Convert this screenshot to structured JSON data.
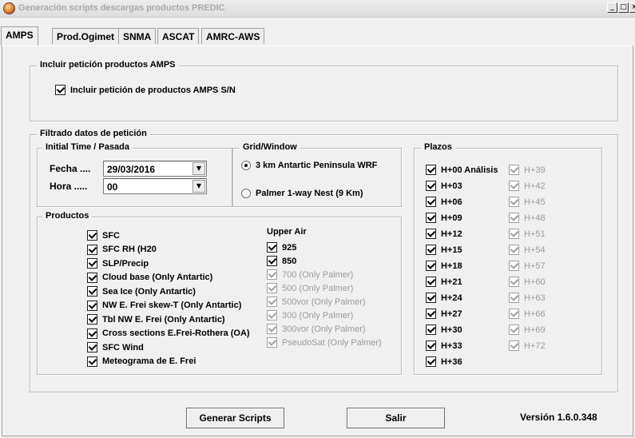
{
  "window": {
    "title": "Generación scripts descargas productos PREDIC",
    "buttons": {
      "minimize": "_",
      "maximize": "□",
      "close": "×"
    }
  },
  "tabs": [
    "AMPS",
    "Prod.Ogimet",
    "SNMA",
    "ASCAT",
    "AMRC-AWS"
  ],
  "incluir_group": {
    "legend": "Incluir petición productos AMPS",
    "checkbox_label": "Incluir petición de productos AMPS  S/N"
  },
  "filtrado_group": {
    "legend": "Filtrado datos de petición",
    "initial_time": {
      "legend": "Initial Time / Pasada",
      "fecha_label": "Fecha ....",
      "fecha_value": "29/03/2016",
      "hora_label": "Hora .....",
      "hora_value": "00"
    },
    "grid_window": {
      "legend": "Grid/Window",
      "options": [
        "3 km Antartic Peninsula WRF",
        "Palmer 1-way Nest (9 Km)"
      ],
      "selected": 0
    },
    "productos": {
      "legend": "Productos",
      "items": [
        "SFC",
        "SFC RH (H20",
        "SLP/Precip",
        "Cloud base (Only Antartic)",
        "Sea Ice (Only Antartic)",
        "NW  E. Frei skew-T (Only Antartic)",
        "Tbl NW E. Frei (Only Antartic)",
        "Cross sections E.Frei-Rothera (OA)",
        "SFC Wind",
        " Meteograma de E. Frei"
      ],
      "upper_air_label": "Upper Air",
      "upper_air_items": [
        {
          "label": "925",
          "enabled": true
        },
        {
          "label": "850",
          "enabled": true
        },
        {
          "label": "700 (Only Palmer)",
          "enabled": false
        },
        {
          "label": "500 (Only Palmer)",
          "enabled": false
        },
        {
          "label": "500vor (Only Palmer)",
          "enabled": false
        },
        {
          "label": "300 (Only Palmer)",
          "enabled": false
        },
        {
          "label": "300vor (Only Palmer)",
          "enabled": false
        },
        {
          "label": "PseudoSat (Only Palmer)",
          "enabled": false
        }
      ]
    },
    "plazos": {
      "legend": "Plazos",
      "col1": [
        "H+00 Análisis",
        "H+03",
        "H+06",
        "H+09",
        "H+12",
        "H+15",
        "H+18",
        "H+21",
        "H+24",
        "H+27",
        "H+30",
        "H+33",
        "H+36"
      ],
      "col2": [
        "H+39",
        "H+42",
        "H+45",
        "H+48",
        "H+51",
        "H+54",
        "H+57",
        "H+60",
        "H+63",
        "H+66",
        "H+69",
        "H+72"
      ]
    }
  },
  "footer": {
    "generar_label": "Generar Scripts",
    "salir_label": "Salir",
    "version": "Versión 1.6.0.348"
  }
}
